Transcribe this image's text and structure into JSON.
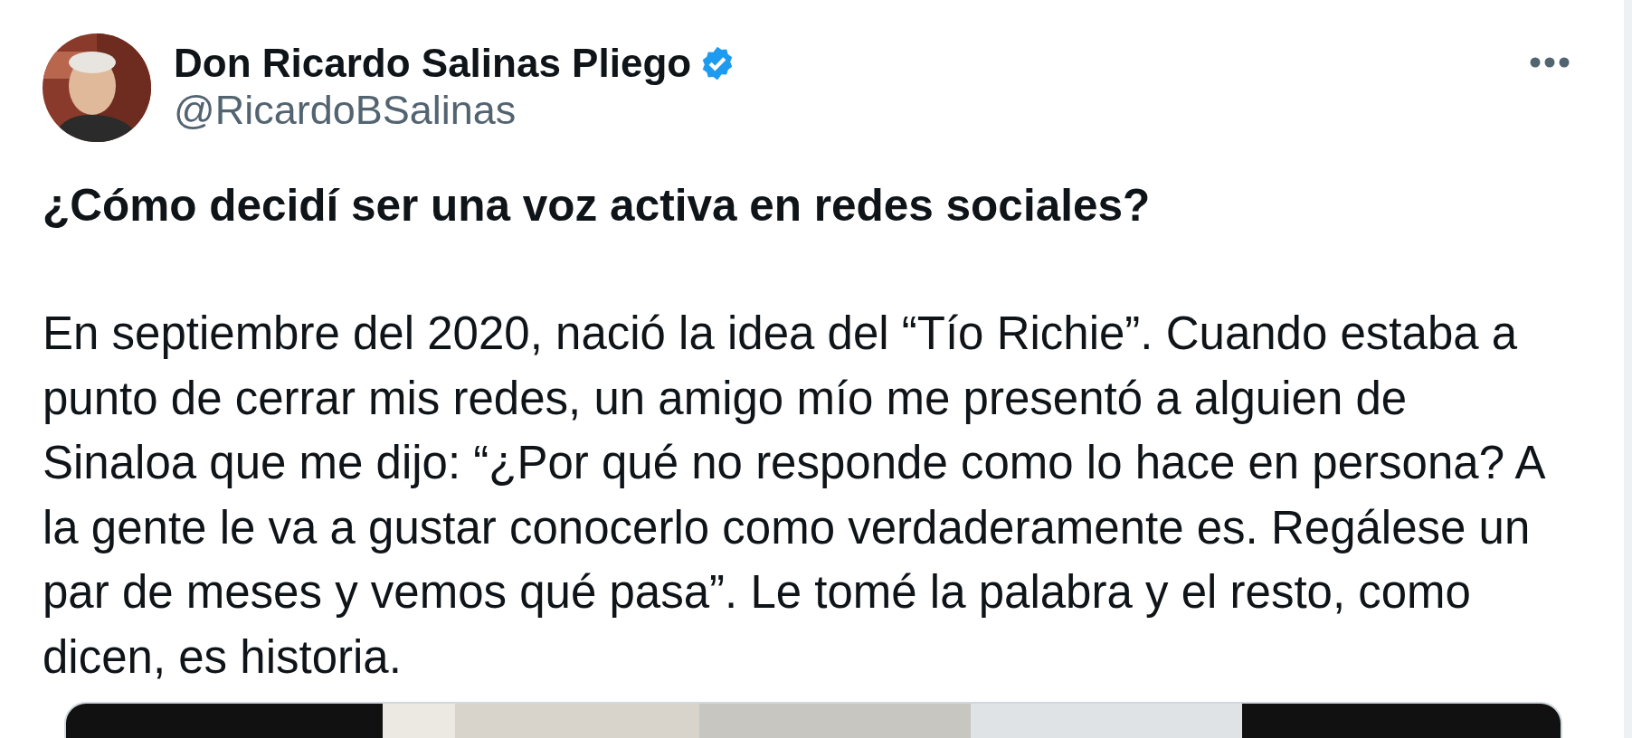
{
  "author": {
    "name": "Don Ricardo Salinas Pliego",
    "verified": true,
    "handle": "@RicardoBSalinas"
  },
  "post": {
    "heading": "¿Cómo decidí ser una voz activa en redes sociales?",
    "lines": [
      "En septiembre del 2020, nació la idea del “Tío Richie”. Cuando estaba a",
      "punto de cerrar mis redes, un amigo mío me presentó a alguien de",
      "Sinaloa que me dijo: “¿Por qué no responde como lo hace en persona? A",
      "la gente le va a gustar conocerlo como verdaderamente es. Regálese un",
      "par de meses y vemos qué pasa”. Le tomé la palabra y el resto, como",
      "dicen, es historia."
    ]
  }
}
